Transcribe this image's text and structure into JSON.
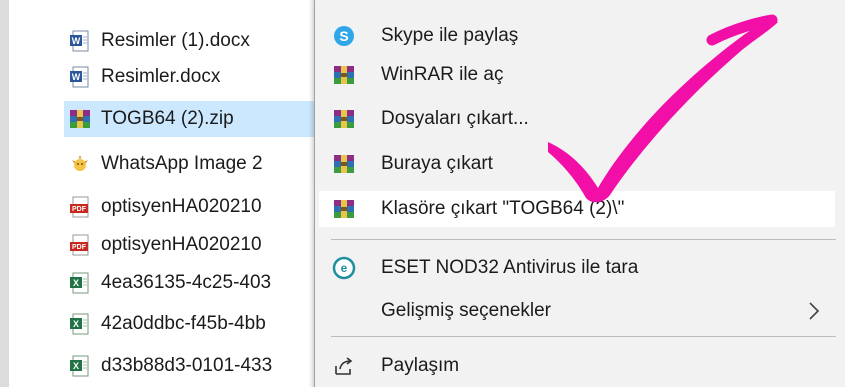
{
  "files": [
    {
      "name": "Resimler (1).docx",
      "icon": "word-doc-icon",
      "selected": false
    },
    {
      "name": "Resimler.docx",
      "icon": "word-doc-icon",
      "selected": false
    },
    {
      "name": "TOGB64 (2).zip",
      "icon": "winrar-archive-icon",
      "selected": true
    },
    {
      "name": "WhatsApp Image 2",
      "icon": "image-file-icon",
      "selected": false
    },
    {
      "name": "optisyenHA020210",
      "icon": "pdf-file-icon",
      "selected": false
    },
    {
      "name": "optisyenHA020210",
      "icon": "pdf-file-icon",
      "selected": false
    },
    {
      "name": "4ea36135-4c25-403",
      "icon": "excel-file-icon",
      "selected": false
    },
    {
      "name": "42a0ddbc-f45b-4bb",
      "icon": "excel-file-icon",
      "selected": false
    },
    {
      "name": "d33b88d3-0101-433",
      "icon": "excel-file-icon",
      "selected": false
    }
  ],
  "context_menu": {
    "items": [
      {
        "label": "Skype ile paylaş",
        "icon": "skype-icon"
      },
      {
        "label": "WinRAR ile aç",
        "icon": "winrar-icon"
      },
      {
        "label": "Dosyaları çıkart...",
        "icon": "winrar-icon"
      },
      {
        "label": "Buraya çıkart",
        "icon": "winrar-icon"
      },
      {
        "label": "Klasöre çıkart \"TOGB64 (2)\\\"",
        "icon": "winrar-icon",
        "highlighted": true
      },
      {
        "label": "ESET NOD32 Antivirus ile tara",
        "icon": "eset-icon"
      },
      {
        "label": "Gelişmiş seçenekler",
        "icon": "",
        "has_submenu": true
      },
      {
        "label": "Paylaşım",
        "icon": "share-icon"
      }
    ]
  },
  "colors": {
    "selection": "#cce8ff",
    "menu_bg": "#f2f2f2",
    "annotation_check": "#f20fa8",
    "skype_blue": "#2ea6e8",
    "eset_teal": "#1f8f9e"
  }
}
